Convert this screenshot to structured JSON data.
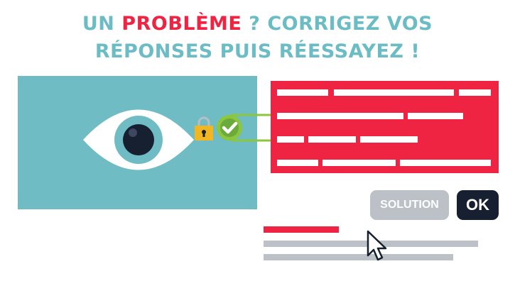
{
  "headline": {
    "part1": "UN ",
    "highlight": "PROBLÈME",
    "part2": " ? CORRIGEZ VOS",
    "line2": "RÉPONSES PUIS RÉESSAYEZ !"
  },
  "buttons": {
    "solution_label": "SOLUTION",
    "ok_label": "OK"
  },
  "colors": {
    "teal": "#6fbcc4",
    "red": "#ef2342",
    "gray": "#bcc1c7",
    "navy": "#172030",
    "lock_gold": "#f3b623",
    "check_green": "#8cc63f"
  },
  "icons": [
    "eye-icon",
    "lock-icon",
    "checkmark-icon",
    "cursor-icon"
  ]
}
